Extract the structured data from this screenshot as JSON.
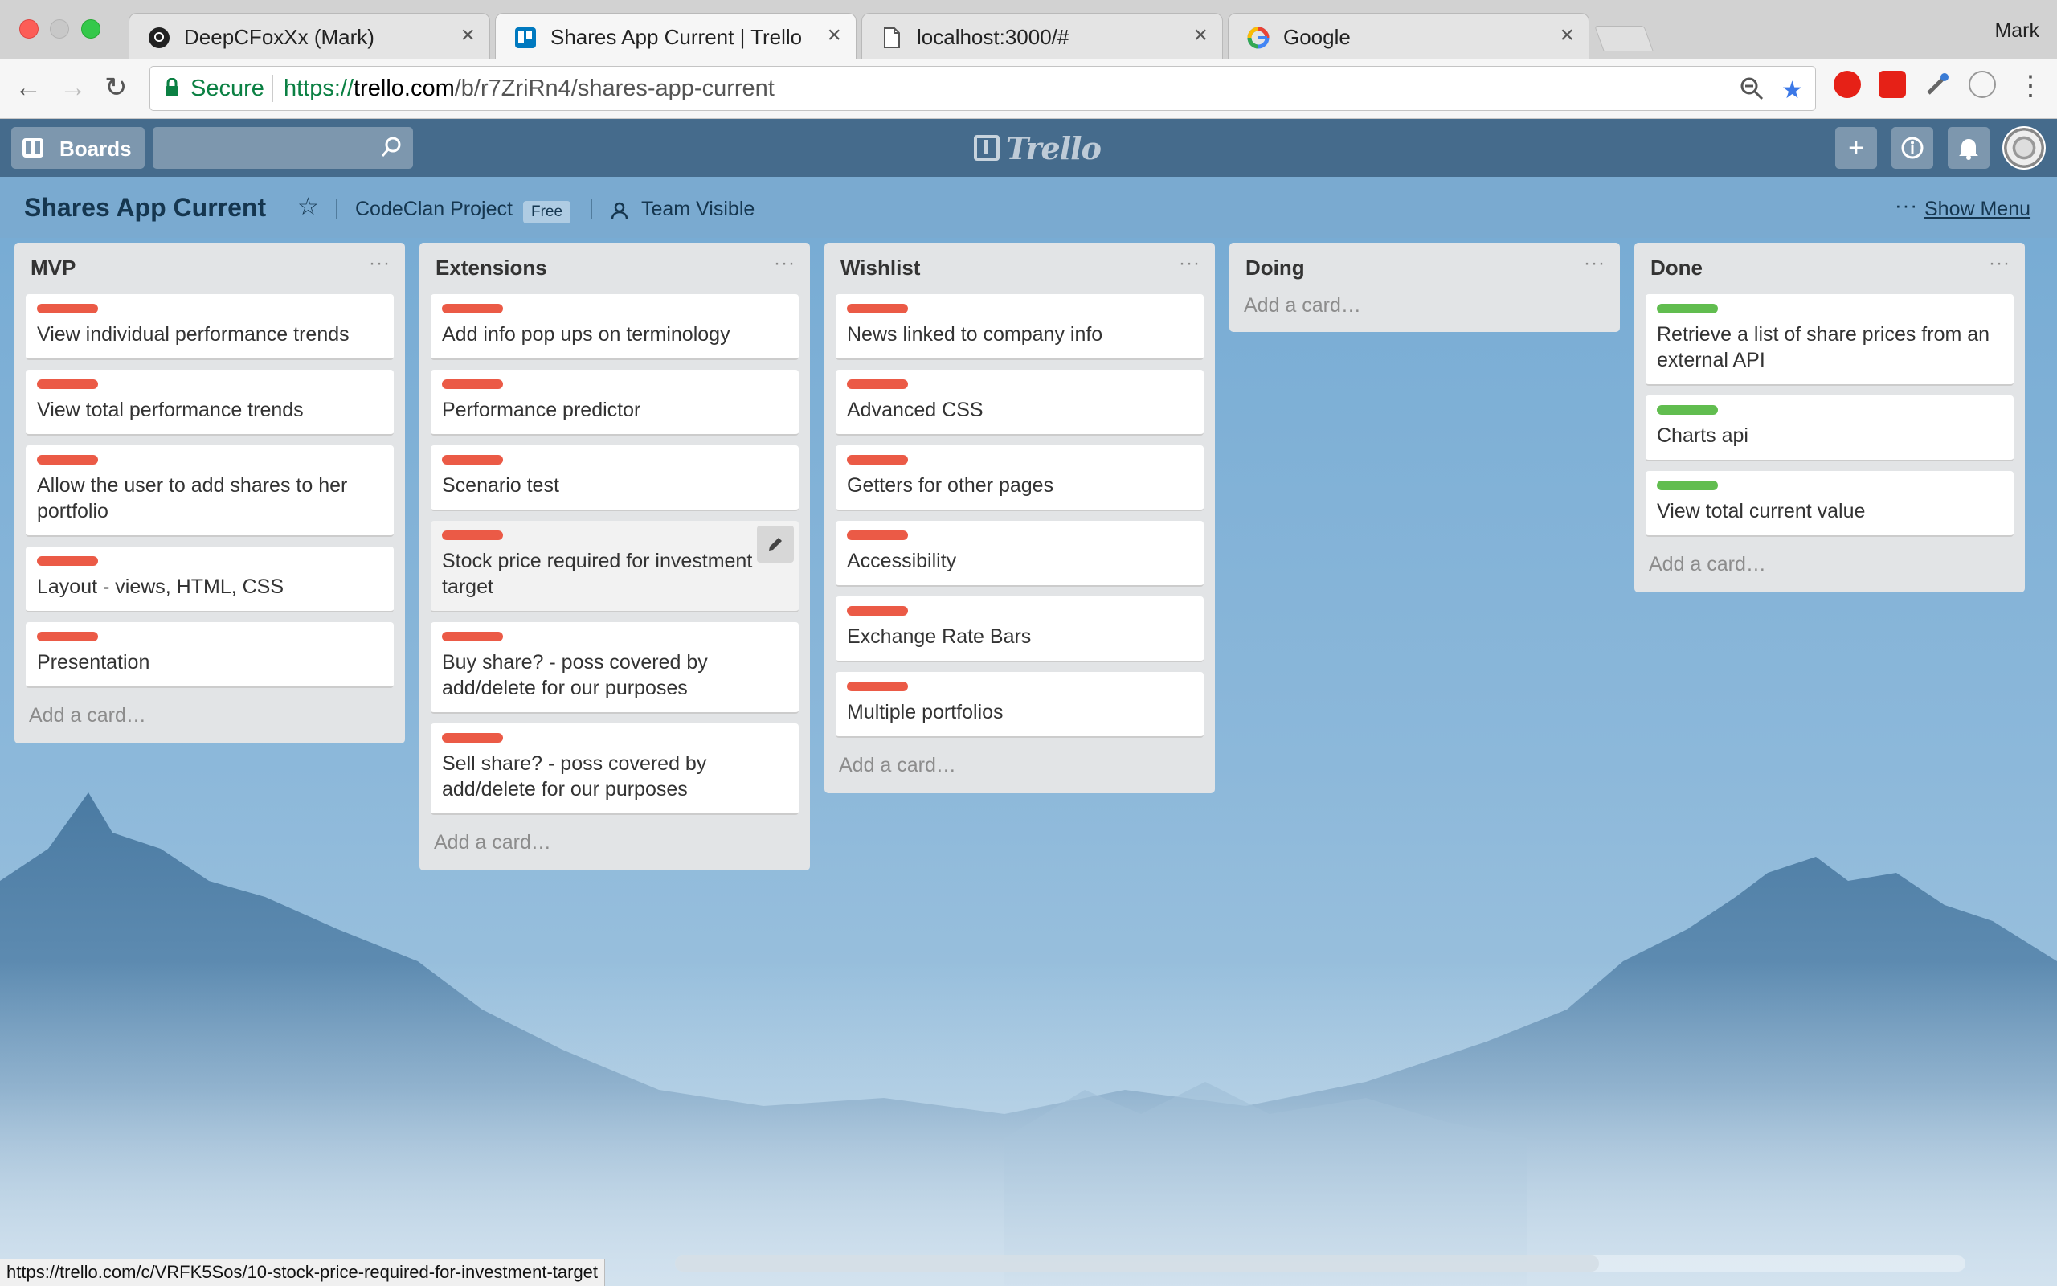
{
  "browser": {
    "tabs": [
      {
        "title": "DeepCFoxXx (Mark)",
        "icon": "github-icon",
        "active": false
      },
      {
        "title": "Shares App Current | Trello",
        "icon": "trello-icon",
        "active": true
      },
      {
        "title": "localhost:3000/#",
        "icon": "page-icon",
        "active": false
      },
      {
        "title": "Google",
        "icon": "google-icon",
        "active": false
      }
    ],
    "profile_name": "Mark",
    "secure_label": "Secure",
    "url": {
      "scheme": "https://",
      "host": "trello.com",
      "path": "/b/r7ZriRn4/shares-app-current"
    },
    "status_url": "https://trello.com/c/VRFK5Sos/10-stock-price-required-for-investment-target"
  },
  "trello": {
    "boards_label": "Boards",
    "search_value": "",
    "logo_text": "Trello"
  },
  "board": {
    "title": "Shares App Current",
    "team": "CodeClan Project",
    "team_badge": "Free",
    "visibility": "Team Visible",
    "show_menu": "Show Menu"
  },
  "colors": {
    "label_red": "#eb5a46",
    "label_green": "#61bd4f",
    "header_bg": "#3c6080"
  },
  "add_card_label": "Add a card…",
  "lists": [
    {
      "name": "MVP",
      "cards": [
        {
          "text": "View individual performance trends",
          "label": "red"
        },
        {
          "text": "View total performance trends",
          "label": "red"
        },
        {
          "text": "Allow the user to add shares to her portfolio",
          "label": "red"
        },
        {
          "text": "Layout - views, HTML, CSS",
          "label": "red"
        },
        {
          "text": "Presentation",
          "label": "red"
        }
      ]
    },
    {
      "name": "Extensions",
      "cards": [
        {
          "text": "Add info pop ups on terminology",
          "label": "red"
        },
        {
          "text": "Performance predictor",
          "label": "red"
        },
        {
          "text": "Scenario test",
          "label": "red"
        },
        {
          "text": "Stock price required for investment target",
          "label": "red",
          "hovered": true
        },
        {
          "text": "Buy share? - poss covered by add/delete for our purposes",
          "label": "red"
        },
        {
          "text": "Sell share? - poss covered by add/delete for our purposes",
          "label": "red"
        }
      ]
    },
    {
      "name": "Wishlist",
      "cards": [
        {
          "text": "News linked to company info",
          "label": "red"
        },
        {
          "text": "Advanced CSS",
          "label": "red"
        },
        {
          "text": "Getters for other pages",
          "label": "red"
        },
        {
          "text": "Accessibility",
          "label": "red"
        },
        {
          "text": "Exchange Rate Bars",
          "label": "red"
        },
        {
          "text": "Multiple portfolios",
          "label": "red"
        }
      ]
    },
    {
      "name": "Doing",
      "cards": []
    },
    {
      "name": "Done",
      "cards": [
        {
          "text": "Retrieve a list of share prices from an external API",
          "label": "green"
        },
        {
          "text": "Charts api",
          "label": "green"
        },
        {
          "text": "View total current value",
          "label": "green"
        }
      ]
    }
  ]
}
